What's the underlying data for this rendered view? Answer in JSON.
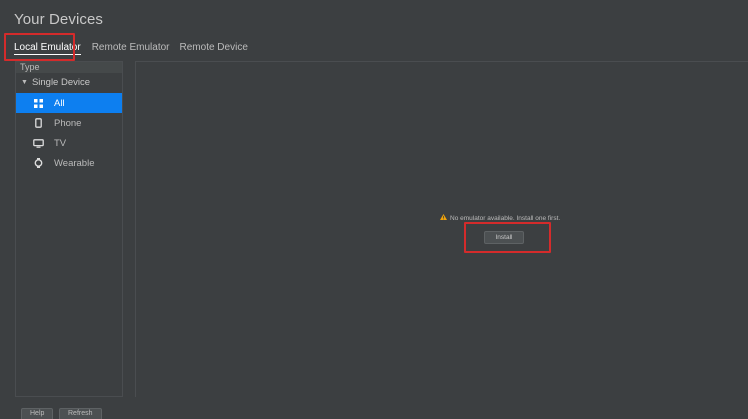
{
  "window": {
    "title": "Your Devices"
  },
  "tabs": [
    {
      "label": "Local Emulator",
      "active": true
    },
    {
      "label": "Remote Emulator",
      "active": false
    },
    {
      "label": "Remote Device",
      "active": false
    }
  ],
  "sidebar": {
    "header": "Type",
    "group_label": "Single Device",
    "items": [
      {
        "label": "All",
        "icon": "grid-icon",
        "selected": true
      },
      {
        "label": "Phone",
        "icon": "phone-icon",
        "selected": false
      },
      {
        "label": "TV",
        "icon": "tv-icon",
        "selected": false
      },
      {
        "label": "Wearable",
        "icon": "watch-icon",
        "selected": false
      }
    ]
  },
  "main": {
    "empty_message": "No emulator available. Install one first.",
    "install_label": "Install"
  },
  "footer": {
    "help_label": "Help",
    "refresh_label": "Refresh"
  },
  "colors": {
    "background": "#3c3f41",
    "selection": "#0d7ff0",
    "highlight": "#d42b2b",
    "warning": "#f0a30a"
  }
}
